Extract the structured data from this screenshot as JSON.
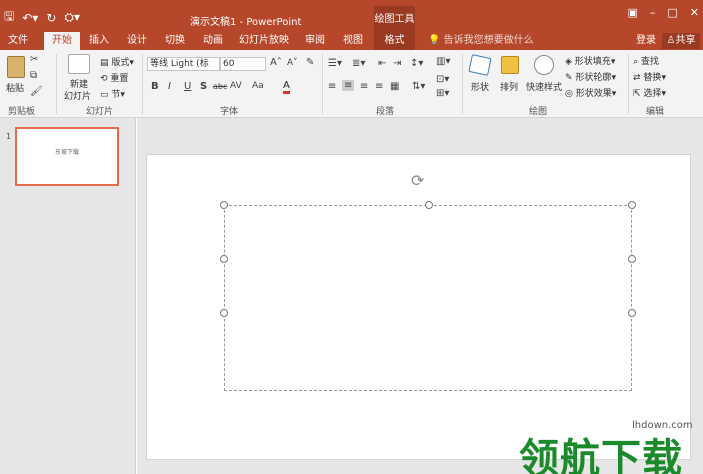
{
  "titlebar": {
    "doc_title": "演示文稿1 - PowerPoint",
    "tools_tab": "绘图工具",
    "qat_icons": [
      "save-icon",
      "undo-icon",
      "redo-icon",
      "customize-icon"
    ]
  },
  "tabs": [
    "文件",
    "开始",
    "插入",
    "设计",
    "切换",
    "动画",
    "幻灯片放映",
    "审阅",
    "视图",
    "格式"
  ],
  "active_tab": "开始",
  "tellme": "告诉我您想要做什么",
  "login": "登录",
  "share": "共享",
  "ribbon": {
    "clipboard": {
      "paste": "粘贴",
      "label": "剪贴板"
    },
    "slides": {
      "new_slide_1": "新建",
      "new_slide_2": "幻灯片",
      "layout": "版式",
      "reset": "重置",
      "section": "节",
      "label": "幻灯片"
    },
    "font": {
      "name": "等线 Light (标",
      "size": "60",
      "label": "字体",
      "bold": "B",
      "italic": "I",
      "underline": "U",
      "shadow": "S",
      "strike": "abc",
      "spacing": "AV",
      "case": "Aa",
      "color": "A"
    },
    "paragraph": {
      "label": "段落"
    },
    "drawing": {
      "shapes": "形状",
      "arrange": "排列",
      "quick_styles": "快速样式",
      "fill": "形状填充",
      "outline": "形状轮廓",
      "effects": "形状效果",
      "label": "绘图"
    },
    "editing": {
      "find": "查找",
      "replace": "替换",
      "select": "选择",
      "label": "编辑"
    }
  },
  "thumbnail": {
    "number": "1",
    "text": "东坡下载"
  },
  "watermark": {
    "logo": "领航下载",
    "url": "lhdown.com"
  }
}
